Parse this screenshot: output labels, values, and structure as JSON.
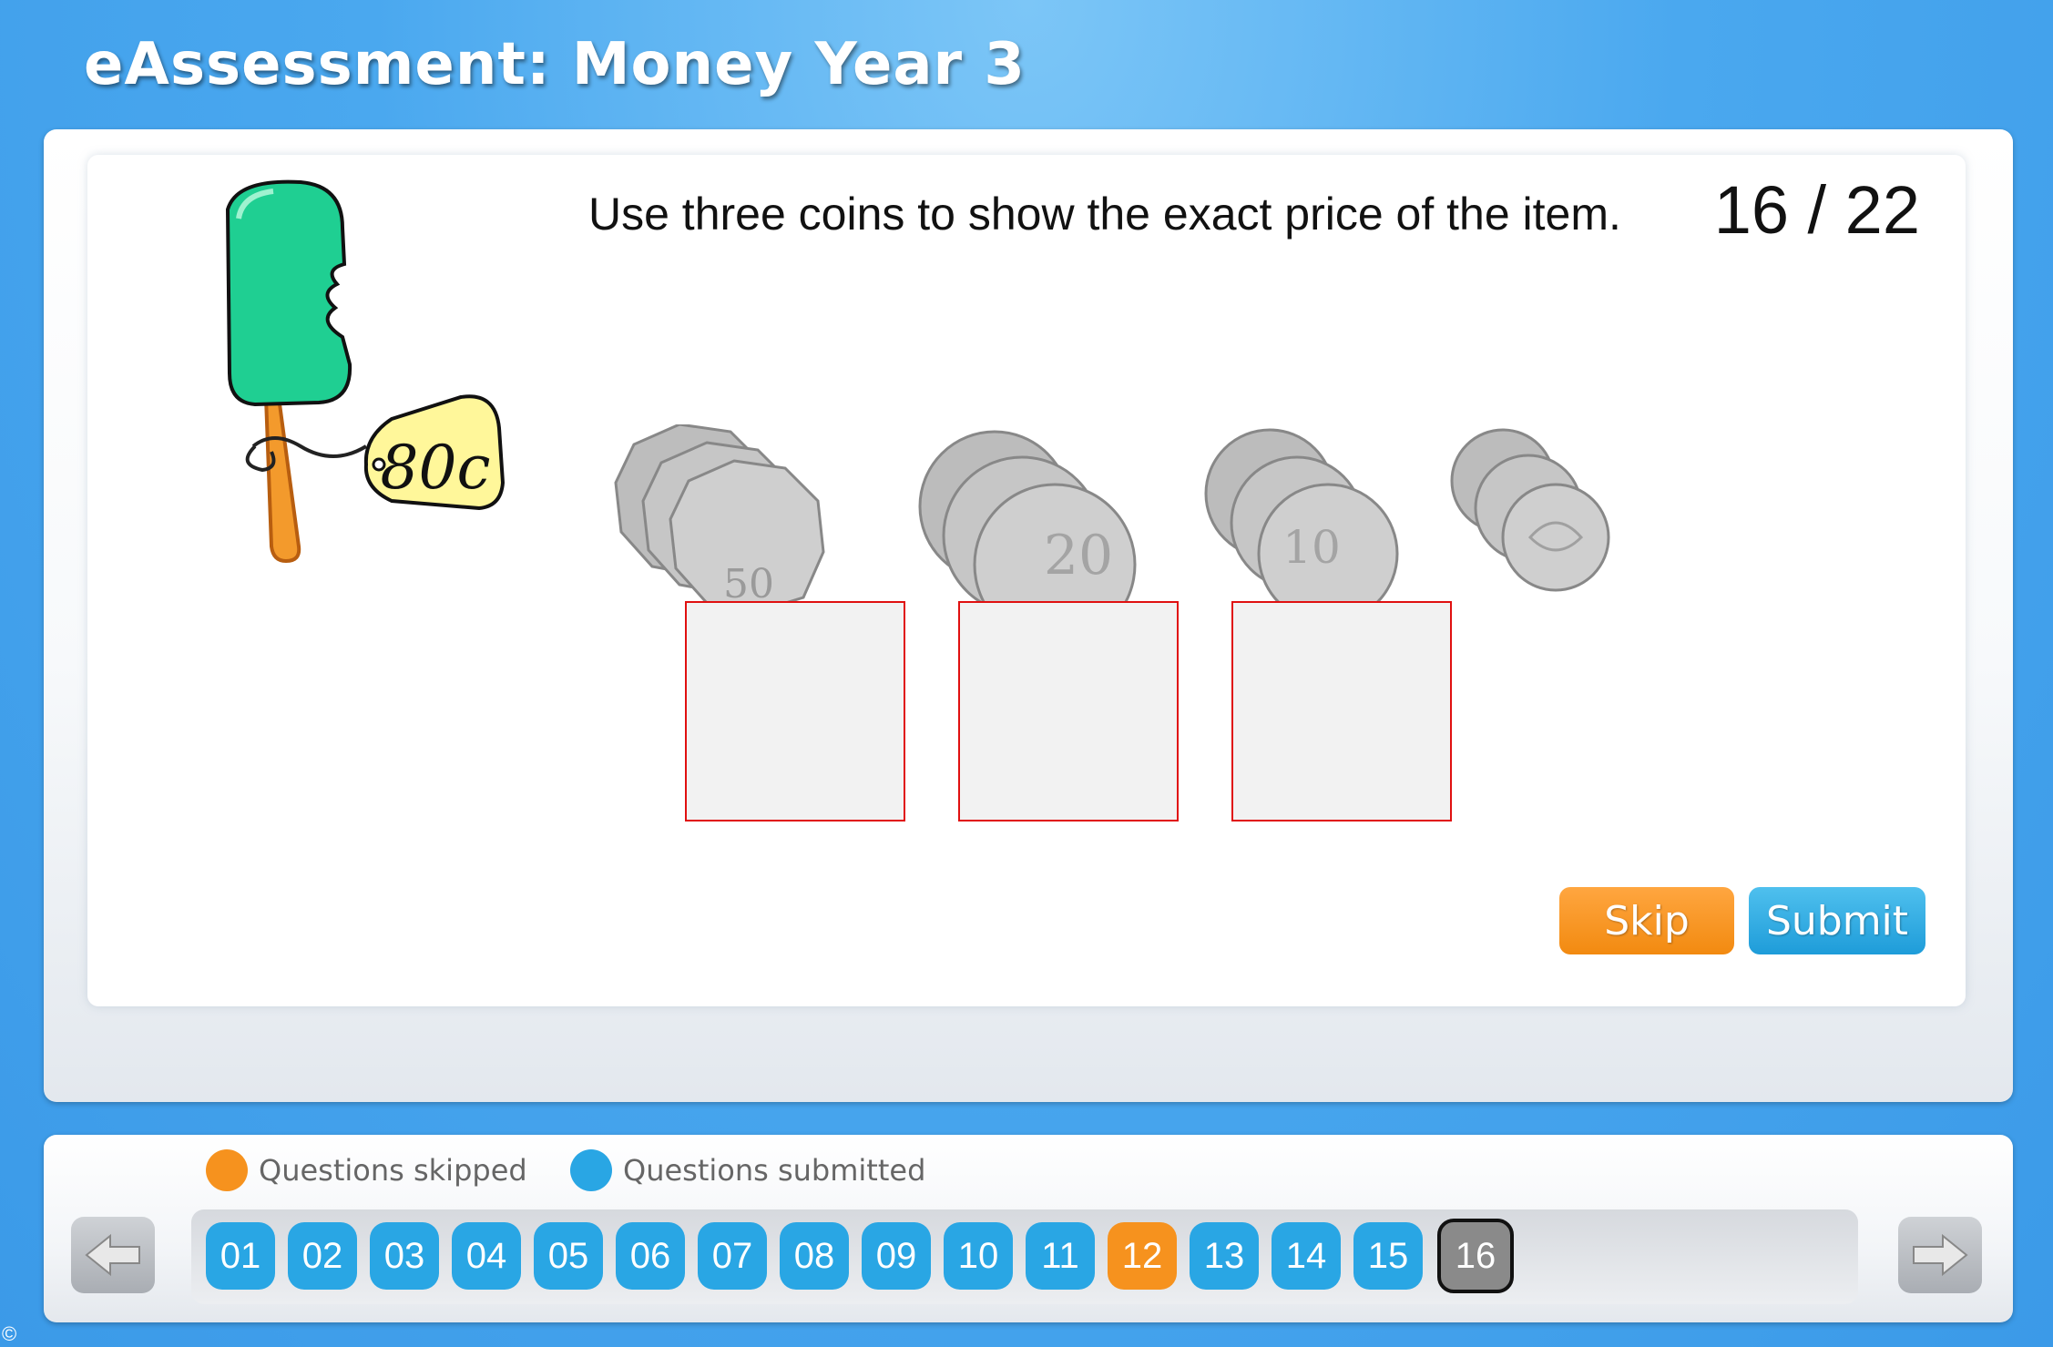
{
  "header": {
    "title": "eAssessment: Money Year 3"
  },
  "question": {
    "counter": "16 / 22",
    "prompt": "Use three coins to show the exact price of the item.",
    "item": {
      "name": "ice-block",
      "price_tag": "80c"
    },
    "coins": [
      {
        "name": "50c coin pile",
        "label": "50"
      },
      {
        "name": "20c coin pile",
        "label": "20"
      },
      {
        "name": "10c coin pile",
        "label": "10"
      },
      {
        "name": "5c coin pile",
        "label": ""
      }
    ],
    "answer_slots": 3
  },
  "actions": {
    "skip_label": "Skip",
    "submit_label": "Submit"
  },
  "legend": {
    "skipped": "Questions skipped",
    "submitted": "Questions submitted"
  },
  "colors": {
    "skipped": "#f6921e",
    "submitted": "#29a6e4",
    "current": "#8a8a8a"
  },
  "navigation": {
    "questions": [
      {
        "label": "01",
        "status": "submitted"
      },
      {
        "label": "02",
        "status": "submitted"
      },
      {
        "label": "03",
        "status": "submitted"
      },
      {
        "label": "04",
        "status": "submitted"
      },
      {
        "label": "05",
        "status": "submitted"
      },
      {
        "label": "06",
        "status": "submitted"
      },
      {
        "label": "07",
        "status": "submitted"
      },
      {
        "label": "08",
        "status": "submitted"
      },
      {
        "label": "09",
        "status": "submitted"
      },
      {
        "label": "10",
        "status": "submitted"
      },
      {
        "label": "11",
        "status": "submitted"
      },
      {
        "label": "12",
        "status": "skipped"
      },
      {
        "label": "13",
        "status": "submitted"
      },
      {
        "label": "14",
        "status": "submitted"
      },
      {
        "label": "15",
        "status": "submitted"
      },
      {
        "label": "16",
        "status": "current"
      }
    ],
    "prev_icon": "arrow-left-icon",
    "next_icon": "arrow-right-icon"
  },
  "footer": {
    "copyright_symbol": "©"
  }
}
